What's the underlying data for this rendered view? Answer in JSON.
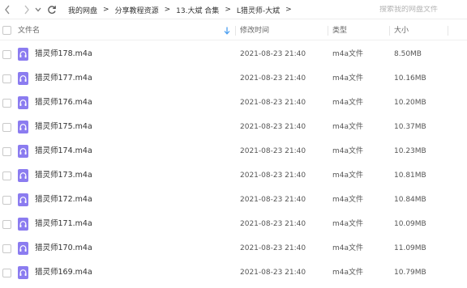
{
  "nav": {
    "back_icon": "chevron-left-icon",
    "forward_icon": "chevron-right-icon",
    "dropdown_icon": "chevron-down-icon",
    "refresh_icon": "refresh-icon",
    "breadcrumb": [
      {
        "label": "我的网盘"
      },
      {
        "label": "分享教程资源"
      },
      {
        "label": "13.大斌 合集"
      },
      {
        "label": "L猎灵师-大斌"
      }
    ],
    "separator": ">",
    "search_placeholder": "搜索我的网盘文件"
  },
  "table": {
    "columns": {
      "name": "文件名",
      "modified": "修改时间",
      "type": "类型",
      "size": "大小"
    },
    "sort_icon": "sort-down-arrow-icon",
    "rows": [
      {
        "name": "猎灵师178.m4a",
        "modified": "2021-08-23 21:40",
        "type": "m4a文件",
        "size": "8.50MB"
      },
      {
        "name": "猎灵师177.m4a",
        "modified": "2021-08-23 21:40",
        "type": "m4a文件",
        "size": "10.16MB"
      },
      {
        "name": "猎灵师176.m4a",
        "modified": "2021-08-23 21:40",
        "type": "m4a文件",
        "size": "10.20MB"
      },
      {
        "name": "猎灵师175.m4a",
        "modified": "2021-08-23 21:40",
        "type": "m4a文件",
        "size": "10.37MB"
      },
      {
        "name": "猎灵师174.m4a",
        "modified": "2021-08-23 21:40",
        "type": "m4a文件",
        "size": "10.23MB"
      },
      {
        "name": "猎灵师173.m4a",
        "modified": "2021-08-23 21:40",
        "type": "m4a文件",
        "size": "10.81MB"
      },
      {
        "name": "猎灵师172.m4a",
        "modified": "2021-08-23 21:40",
        "type": "m4a文件",
        "size": "10.84MB"
      },
      {
        "name": "猎灵师171.m4a",
        "modified": "2021-08-23 21:40",
        "type": "m4a文件",
        "size": "10.09MB"
      },
      {
        "name": "猎灵师170.m4a",
        "modified": "2021-08-23 21:40",
        "type": "m4a文件",
        "size": "11.09MB"
      },
      {
        "name": "猎灵师169.m4a",
        "modified": "2021-08-23 21:40",
        "type": "m4a文件",
        "size": "10.79MB"
      }
    ],
    "file_icon": "audio-file-headphones-icon"
  },
  "colors": {
    "file_icon": "#8b7cf0",
    "sort_arrow": "#4a9ef0"
  }
}
